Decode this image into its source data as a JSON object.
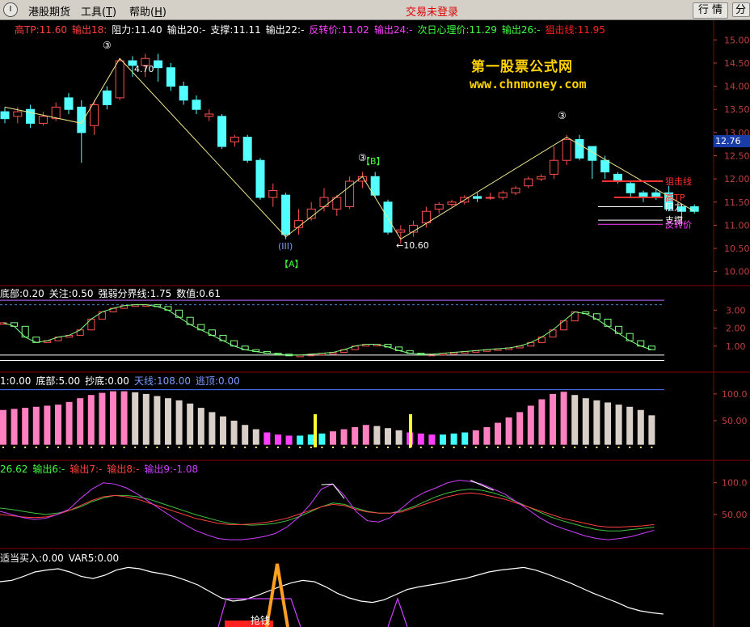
{
  "menu": {
    "system_icon": "I",
    "items": [
      {
        "label": "港股期货",
        "key": ""
      },
      {
        "label": "工具",
        "key": "T"
      },
      {
        "label": "帮助",
        "key": "H"
      }
    ],
    "status": "交易未登录",
    "buttons": {
      "quote": "行 情",
      "chart": "分 析"
    }
  },
  "colors": {
    "up_candle": "#ff5050",
    "down_candle": "#54ffff",
    "grid": "#8b0000",
    "axis_text": "#c04040"
  },
  "main_panel": {
    "indicators": [
      {
        "label": "高TP:11.60",
        "color": "#ff4040"
      },
      {
        "label": "输出18:",
        "color": "#ff4040"
      },
      {
        "label": "阻力:11.40",
        "color": "#ffffff"
      },
      {
        "label": "输出20:-",
        "color": "#ffffff"
      },
      {
        "label": "支撑:11.11",
        "color": "#ffffff"
      },
      {
        "label": "输出22:-",
        "color": "#ffffff"
      },
      {
        "label": "反转价:11.02",
        "color": "#ff40ff"
      },
      {
        "label": "输出24:-",
        "color": "#ff40ff"
      },
      {
        "label": "次日心理价:11.29",
        "color": "#40ff40"
      },
      {
        "label": "输出26:-",
        "color": "#40ff40"
      },
      {
        "label": "狙击线:11.95",
        "color": "#ff2020"
      }
    ],
    "watermark": {
      "title": "第一股票公式网",
      "url": "www.chnmoney.com"
    },
    "price_tag": "12.76",
    "y_ticks": [
      "15.00",
      "14.50",
      "14.00",
      "13.50",
      "13.00",
      "12.50",
      "12.00",
      "11.50",
      "11.00",
      "10.50",
      "10.00"
    ],
    "annotations": {
      "high_price": "4.70",
      "low_price": "←10.60",
      "label_a": "【A】",
      "label_b": "【B】",
      "label_iii": "(III)",
      "circle_three": "③"
    },
    "right_labels": [
      {
        "text": "狙击线",
        "color": "#ff3030"
      },
      {
        "text": "高TP",
        "color": "#ff3030"
      },
      {
        "text": "阻力",
        "color": "#ffffff"
      },
      {
        "text": "支撑",
        "color": "#ffffff"
      },
      {
        "text": "反转价",
        "color": "#ff40ff"
      }
    ]
  },
  "panel2": {
    "indicators": [
      {
        "label": "底部:0.20",
        "color": "#ffffff"
      },
      {
        "label": "关注:0.50",
        "color": "#ffffff"
      },
      {
        "label": "强弱分界线:1.75",
        "color": "#ffffff"
      },
      {
        "label": "数值:0.61",
        "color": "#ffffff"
      }
    ],
    "y_ticks": [
      "3.00",
      "2.00",
      "1.00"
    ]
  },
  "panel3": {
    "indicators": [
      {
        "label": "1:0.00",
        "color": "#ffffff"
      },
      {
        "label": "底部:5.00",
        "color": "#ffffff"
      },
      {
        "label": "抄底:0.00",
        "color": "#ffffff"
      },
      {
        "label": "天线:108.00",
        "color": "#7b9cff"
      },
      {
        "label": "逃顶:0.00",
        "color": "#7b9cff"
      }
    ],
    "y_ticks": [
      "100.0",
      "50.00"
    ]
  },
  "panel4": {
    "indicators": [
      {
        "label": "26.62",
        "color": "#40ff40"
      },
      {
        "label": "输出6:-",
        "color": "#40ff40"
      },
      {
        "label": "输出7:-",
        "color": "#ff4040"
      },
      {
        "label": "输出8:-",
        "color": "#ff4040"
      },
      {
        "label": "输出9:-1.08",
        "color": "#d040ff"
      }
    ],
    "y_ticks": [
      "100.0",
      "50.00"
    ]
  },
  "panel5": {
    "indicators": [
      {
        "label": "适当买入:0.00",
        "color": "#ffffff"
      },
      {
        "label": "VAR5:0.00",
        "color": "#ffffff"
      }
    ],
    "signal_label": "抢钱"
  },
  "chart_data": {
    "type": "candlestick",
    "candles": [
      {
        "o": 13.45,
        "c": 13.3,
        "h": 13.55,
        "l": 13.2
      },
      {
        "o": 13.35,
        "c": 13.45,
        "h": 13.55,
        "l": 13.2
      },
      {
        "o": 13.5,
        "c": 13.2,
        "h": 13.6,
        "l": 13.1
      },
      {
        "o": 13.2,
        "c": 13.35,
        "h": 13.45,
        "l": 13.15
      },
      {
        "o": 13.3,
        "c": 13.55,
        "h": 13.65,
        "l": 13.25
      },
      {
        "o": 13.75,
        "c": 13.5,
        "h": 13.85,
        "l": 13.4
      },
      {
        "o": 13.55,
        "c": 13.0,
        "h": 13.7,
        "l": 12.35
      },
      {
        "o": 13.15,
        "c": 13.6,
        "h": 13.7,
        "l": 12.95
      },
      {
        "o": 13.9,
        "c": 13.6,
        "h": 14.0,
        "l": 13.5
      },
      {
        "o": 13.75,
        "c": 14.55,
        "h": 14.6,
        "l": 13.7
      },
      {
        "o": 14.55,
        "c": 14.45,
        "h": 14.65,
        "l": 14.2
      },
      {
        "o": 14.45,
        "c": 14.6,
        "h": 14.7,
        "l": 14.2
      },
      {
        "o": 14.55,
        "c": 14.4,
        "h": 14.7,
        "l": 14.1
      },
      {
        "o": 14.4,
        "c": 14.0,
        "h": 14.5,
        "l": 13.9
      },
      {
        "o": 14.0,
        "c": 13.7,
        "h": 14.1,
        "l": 13.6
      },
      {
        "o": 13.7,
        "c": 13.5,
        "h": 13.8,
        "l": 13.4
      },
      {
        "o": 13.35,
        "c": 13.4,
        "h": 13.5,
        "l": 13.25
      },
      {
        "o": 13.35,
        "c": 12.7,
        "h": 13.4,
        "l": 12.65
      },
      {
        "o": 12.8,
        "c": 12.9,
        "h": 12.95,
        "l": 12.7
      },
      {
        "o": 12.9,
        "c": 12.4,
        "h": 12.95,
        "l": 12.35
      },
      {
        "o": 12.4,
        "c": 11.6,
        "h": 12.45,
        "l": 11.55
      },
      {
        "o": 11.6,
        "c": 11.75,
        "h": 11.9,
        "l": 11.4
      },
      {
        "o": 11.65,
        "c": 10.8,
        "h": 11.7,
        "l": 10.7
      },
      {
        "o": 10.95,
        "c": 11.1,
        "h": 11.35,
        "l": 10.8
      },
      {
        "o": 11.15,
        "c": 11.35,
        "h": 11.5,
        "l": 11.1
      },
      {
        "o": 11.4,
        "c": 11.6,
        "h": 11.8,
        "l": 11.3
      },
      {
        "o": 11.35,
        "c": 11.6,
        "h": 11.65,
        "l": 11.2
      },
      {
        "o": 11.4,
        "c": 11.95,
        "h": 12.05,
        "l": 11.35
      },
      {
        "o": 11.95,
        "c": 12.05,
        "h": 12.15,
        "l": 11.8
      },
      {
        "o": 12.05,
        "c": 11.65,
        "h": 12.15,
        "l": 11.6
      },
      {
        "o": 11.5,
        "c": 10.85,
        "h": 11.55,
        "l": 10.8
      },
      {
        "o": 10.85,
        "c": 10.9,
        "h": 11.0,
        "l": 10.6
      },
      {
        "o": 10.85,
        "c": 11.0,
        "h": 11.1,
        "l": 10.75
      },
      {
        "o": 11.05,
        "c": 11.3,
        "h": 11.4,
        "l": 10.95
      },
      {
        "o": 11.35,
        "c": 11.45,
        "h": 11.5,
        "l": 11.25
      },
      {
        "o": 11.45,
        "c": 11.5,
        "h": 11.55,
        "l": 11.4
      },
      {
        "o": 11.5,
        "c": 11.6,
        "h": 11.65,
        "l": 11.45
      },
      {
        "o": 11.62,
        "c": 11.58,
        "h": 11.7,
        "l": 11.5
      },
      {
        "o": 11.6,
        "c": 11.6,
        "h": 11.7,
        "l": 11.55
      },
      {
        "o": 11.6,
        "c": 11.7,
        "h": 11.75,
        "l": 11.55
      },
      {
        "o": 11.7,
        "c": 11.8,
        "h": 11.85,
        "l": 11.65
      },
      {
        "o": 11.85,
        "c": 12.0,
        "h": 12.05,
        "l": 11.8
      },
      {
        "o": 12.0,
        "c": 12.05,
        "h": 12.1,
        "l": 11.95
      },
      {
        "o": 12.1,
        "c": 12.4,
        "h": 12.7,
        "l": 12.0
      },
      {
        "o": 12.4,
        "c": 12.85,
        "h": 12.95,
        "l": 12.3
      },
      {
        "o": 12.85,
        "c": 12.45,
        "h": 12.95,
        "l": 12.4
      },
      {
        "o": 12.7,
        "c": 12.4,
        "h": 12.7,
        "l": 12.0
      },
      {
        "o": 12.4,
        "c": 12.15,
        "h": 12.5,
        "l": 12.0
      },
      {
        "o": 12.1,
        "c": 11.95,
        "h": 12.15,
        "l": 11.9
      },
      {
        "o": 11.9,
        "c": 11.7,
        "h": 11.95,
        "l": 11.6
      },
      {
        "o": 11.7,
        "c": 11.6,
        "h": 11.75,
        "l": 11.5
      },
      {
        "o": 11.7,
        "c": 11.6,
        "h": 11.8,
        "l": 11.55
      },
      {
        "o": 11.7,
        "c": 11.35,
        "h": 11.85,
        "l": 11.3
      },
      {
        "o": 11.4,
        "c": 11.3,
        "h": 11.45,
        "l": 11.0
      },
      {
        "o": 11.4,
        "c": 11.3,
        "h": 11.45,
        "l": 11.25
      }
    ],
    "levels": {
      "sniper_line": 11.95,
      "high_tp": 11.6,
      "resistance": 11.4,
      "support": 11.11,
      "reversal_price": 11.02,
      "next_day_price": 11.29
    },
    "y_range": [
      9.75,
      15.25
    ]
  }
}
